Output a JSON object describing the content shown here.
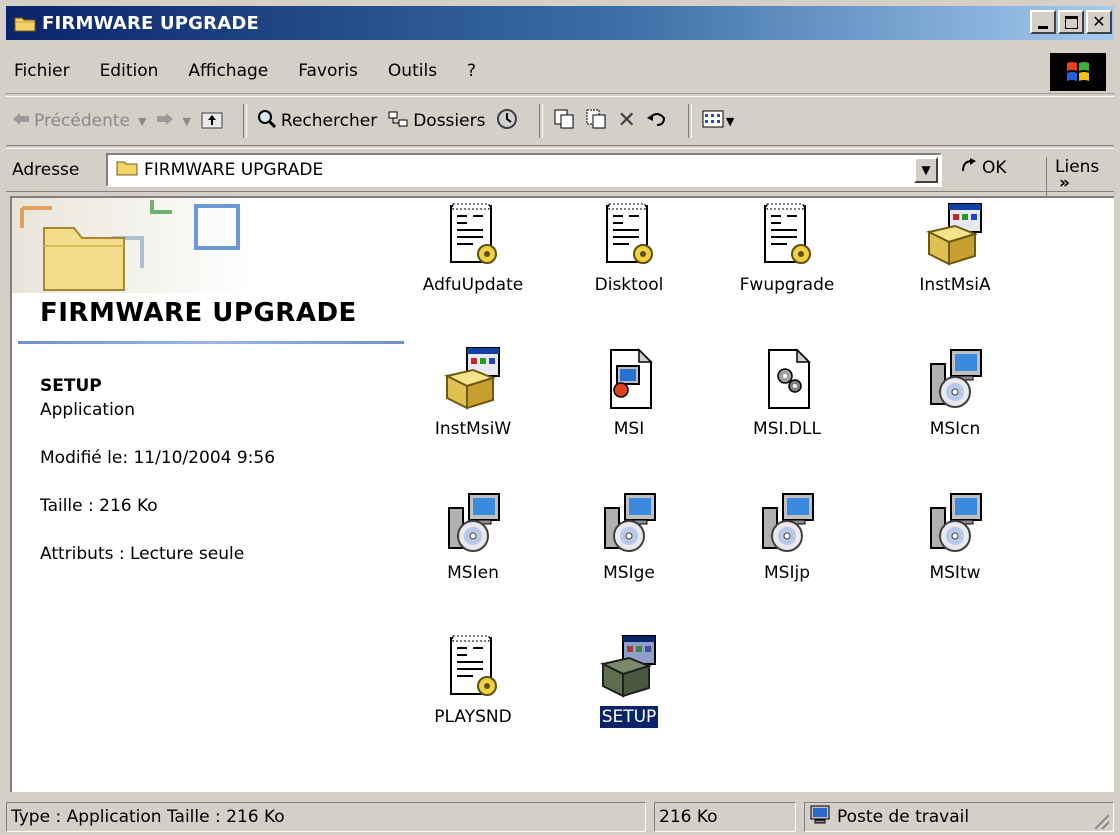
{
  "window": {
    "title": "FIRMWARE UPGRADE"
  },
  "menu": [
    "Fichier",
    "Edition",
    "Affichage",
    "Favoris",
    "Outils",
    "?"
  ],
  "toolbar": {
    "back": "Précédente",
    "search": "Rechercher",
    "folders": "Dossiers"
  },
  "address": {
    "label": "Adresse",
    "value": "FIRMWARE UPGRADE",
    "go": "OK",
    "links": "Liens"
  },
  "side": {
    "title": "FIRMWARE UPGRADE",
    "name": "SETUP",
    "type": "Application",
    "modified": "Modifié le: 11/10/2004 9:56",
    "size": "Taille : 216 Ko",
    "attributes": "Attributs : Lecture seule"
  },
  "files": [
    {
      "name": "AdfuUpdate",
      "icon": "batch-file-icon"
    },
    {
      "name": "Disktool",
      "icon": "batch-file-icon"
    },
    {
      "name": "Fwupgrade",
      "icon": "batch-file-icon"
    },
    {
      "name": "InstMsiA",
      "icon": "installer-box-icon"
    },
    {
      "name": "InstMsiW",
      "icon": "installer-box-icon"
    },
    {
      "name": "MSI",
      "icon": "msi-package-icon"
    },
    {
      "name": "MSI.DLL",
      "icon": "dll-file-icon"
    },
    {
      "name": "MSIcn",
      "icon": "computer-cd-setup-icon"
    },
    {
      "name": "MSIen",
      "icon": "computer-cd-setup-icon"
    },
    {
      "name": "MSIge",
      "icon": "computer-cd-setup-icon"
    },
    {
      "name": "MSIjp",
      "icon": "computer-cd-setup-icon"
    },
    {
      "name": "MSItw",
      "icon": "computer-cd-setup-icon"
    },
    {
      "name": "PLAYSND",
      "icon": "batch-file-icon"
    },
    {
      "name": "SETUP",
      "icon": "installer-box-icon",
      "selected": true
    }
  ],
  "status": {
    "info": "Type : Application Taille  : 216 Ko",
    "size": "216 Ko",
    "zone": "Poste de travail"
  },
  "colors": {
    "title_start": "#0a246a",
    "title_end": "#a6caf0",
    "selection": "#0a246a",
    "chrome": "#d4d0c8"
  }
}
